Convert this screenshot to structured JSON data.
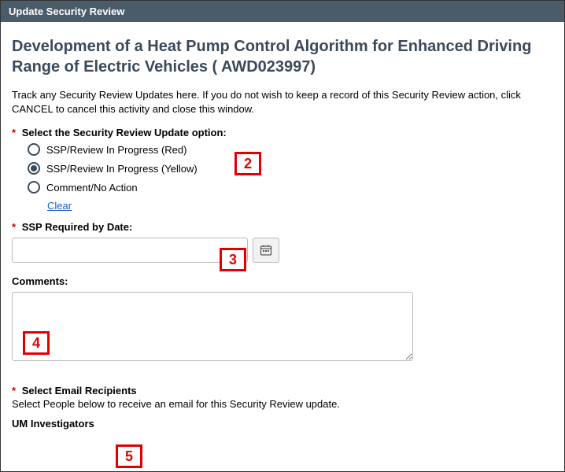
{
  "header": {
    "title": "Update Security Review"
  },
  "page": {
    "title": "Development of a Heat Pump Control Algorithm for Enhanced Driving Range of Electric Vehicles (  AWD023997)",
    "intro": "Track any Security Review Updates here. If you do not wish to keep a record of this Security Review action, click CANCEL to cancel this activity and close this window."
  },
  "review_option": {
    "label": "Select the Security Review Update option:",
    "options": [
      {
        "label": "SSP/Review In Progress (Red)",
        "selected": false
      },
      {
        "label": "SSP/Review In Progress (Yellow)",
        "selected": true
      },
      {
        "label": "Comment/No Action",
        "selected": false
      }
    ],
    "clear": "Clear"
  },
  "date": {
    "label": "SSP Required by Date:",
    "value": ""
  },
  "comments": {
    "label": "Comments:",
    "value": ""
  },
  "recipients": {
    "label": "Select Email Recipients",
    "help": "Select People below to receive an email for this Security Review update."
  },
  "investigators": {
    "label": "UM Investigators"
  },
  "callouts": {
    "c2": "2",
    "c3": "3",
    "c4": "4",
    "c5": "5"
  }
}
